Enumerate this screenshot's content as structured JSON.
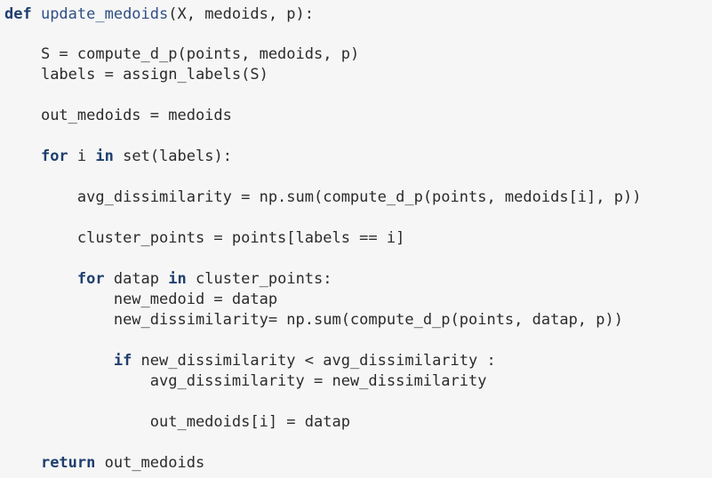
{
  "code": {
    "lines": [
      {
        "indent": "",
        "kw": "def ",
        "fn": "update_medoids",
        "text": "(X, medoids, p):"
      },
      {
        "indent": "    ",
        "kw": "",
        "fn": "",
        "text": "S = compute_d_p(points, medoids, p)"
      },
      {
        "indent": "    ",
        "kw": "",
        "fn": "",
        "text": "labels = assign_labels(S)"
      },
      {
        "indent": "    ",
        "kw": "",
        "fn": "",
        "text": "out_medoids = medoids"
      },
      {
        "indent": "    ",
        "kw": "for ",
        "fn": "",
        "text": "i ",
        "kw2": "in ",
        "text2": "set(labels):"
      },
      {
        "indent": "        ",
        "kw": "",
        "fn": "",
        "text": "avg_dissimilarity = np.sum(compute_d_p(points, medoids[i], p))"
      },
      {
        "indent": "        ",
        "kw": "",
        "fn": "",
        "text": "cluster_points = points[labels == i]"
      },
      {
        "indent": "        ",
        "kw": "for ",
        "fn": "",
        "text": "datap ",
        "kw2": "in ",
        "text2": "cluster_points:"
      },
      {
        "indent": "            ",
        "kw": "",
        "fn": "",
        "text": "new_medoid = datap"
      },
      {
        "indent": "            ",
        "kw": "",
        "fn": "",
        "text": "new_dissimilarity= np.sum(compute_d_p(points, datap, p))"
      },
      {
        "indent": "            ",
        "kw": "if ",
        "fn": "",
        "text": "new_dissimilarity < avg_dissimilarity :"
      },
      {
        "indent": "                ",
        "kw": "",
        "fn": "",
        "text": "avg_dissimilarity = new_dissimilarity"
      },
      {
        "indent": "                ",
        "kw": "",
        "fn": "",
        "text": "out_medoids[i] = datap"
      },
      {
        "indent": "    ",
        "kw": "return ",
        "fn": "",
        "text": "out_medoids"
      }
    ]
  },
  "colors": {
    "background": "#f6f6f6",
    "keyword": "#1f3f6e",
    "function_name": "#2f4f86",
    "text": "#2b2b2b"
  }
}
